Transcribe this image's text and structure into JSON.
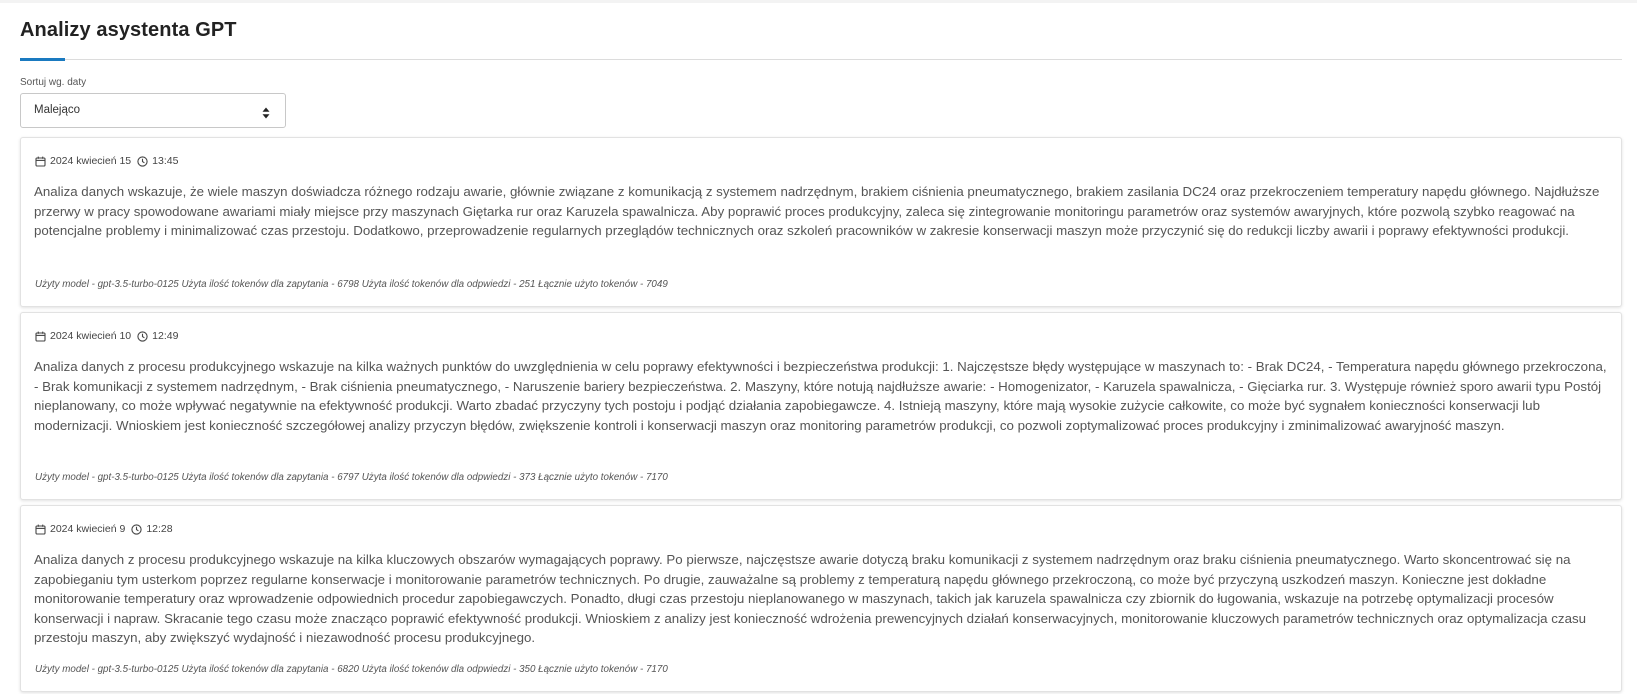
{
  "page": {
    "title": "Analizy asystenta GPT"
  },
  "sort": {
    "label": "Sortuj wg. daty",
    "selected": "Malejąco"
  },
  "colors": {
    "accent": "#1a7ac0",
    "text": "#555555"
  },
  "analyses": [
    {
      "date": "2024 kwiecień 15",
      "time": "13:45",
      "text": "Analiza danych wskazuje, że wiele maszyn doświadcza różnego rodzaju awarie, głównie związane z komunikacją z systemem nadrzędnym, brakiem ciśnienia pneumatycznego, brakiem zasilania DC24 oraz przekroczeniem temperatury napędu głównego. Najdłuższe przerwy w pracy spowodowane awariami miały miejsce przy maszynach Giętarka rur oraz Karuzela spawalnicza. Aby poprawić proces produkcyjny, zaleca się zintegrowanie monitoringu parametrów oraz systemów awaryjnych, które pozwolą szybko reagować na potencjalne problemy i minimalizować czas przestoju. Dodatkowo, przeprowadzenie regularnych przeglądów technicznych oraz szkoleń pracowników w zakresie konserwacji maszyn może przyczynić się do redukcji liczby awarii i poprawy efektywności produkcji.",
      "usage": "Użyty model - gpt-3.5-turbo-0125 Użyta ilość tokenów dla zapytania - 6798 Użyta ilość tokenów dla odpwiedzi - 251 Łącznie użyto tokenów - 7049"
    },
    {
      "date": "2024 kwiecień 10",
      "time": "12:49",
      "text": "Analiza danych z procesu produkcyjnego wskazuje na kilka ważnych punktów do uwzględnienia w celu poprawy efektywności i bezpieczeństwa produkcji: 1. Najczęstsze błędy występujące w maszynach to: - Brak DC24, - Temperatura napędu głównego przekroczona, - Brak komunikacji z systemem nadrzędnym, - Brak ciśnienia pneumatycznego, - Naruszenie bariery bezpieczeństwa. 2. Maszyny, które notują najdłuższe awarie: - Homogenizator, - Karuzela spawalnicza, - Gięciarka rur. 3. Występuje również sporo awarii typu Postój nieplanowany, co może wpływać negatywnie na efektywność produkcji. Warto zbadać przyczyny tych postoju i podjąć działania zapobiegawcze. 4. Istnieją maszyny, które mają wysokie zużycie całkowite, co może być sygnałem konieczności konserwacji lub modernizacji. Wnioskiem jest konieczność szczegółowej analizy przyczyn błędów, zwiększenie kontroli i konserwacji maszyn oraz monitoring parametrów produkcji, co pozwoli zoptymalizować proces produkcyjny i zminimalizować awaryjność maszyn.",
      "usage": "Użyty model - gpt-3.5-turbo-0125 Użyta ilość tokenów dla zapytania - 6797 Użyta ilość tokenów dla odpwiedzi - 373 Łącznie użyto tokenów - 7170"
    },
    {
      "date": "2024 kwiecień 9",
      "time": "12:28",
      "text": "Analiza danych z procesu produkcyjnego wskazuje na kilka kluczowych obszarów wymagających poprawy. Po pierwsze, najczęstsze awarie dotyczą braku komunikacji z systemem nadrzędnym oraz braku ciśnienia pneumatycznego. Warto skoncentrować się na zapobieganiu tym usterkom poprzez regularne konserwacje i monitorowanie parametrów technicznych. Po drugie, zauważalne są problemy z temperaturą napędu głównego przekroczoną, co może być przyczyną uszkodzeń maszyn. Konieczne jest dokładne monitorowanie temperatury oraz wprowadzenie odpowiednich procedur zapobiegawczych. Ponadto, długi czas przestoju nieplanowanego w maszynach, takich jak karuzela spawalnicza czy zbiornik do ługowania, wskazuje na potrzebę optymalizacji procesów konserwacji i napraw. Skracanie tego czasu może znacząco poprawić efektywność produkcji. Wnioskiem z analizy jest konieczność wdrożenia prewencyjnych działań konserwacyjnych, monitorowanie kluczowych parametrów technicznych oraz optymalizacja czasu przestoju maszyn, aby zwiększyć wydajność i niezawodność procesu produkcyjnego.",
      "usage": "Użyty model - gpt-3.5-turbo-0125 Użyta ilość tokenów dla zapytania - 6820 Użyta ilość tokenów dla odpwiedzi - 350 Łącznie użyto tokenów - 7170"
    }
  ]
}
